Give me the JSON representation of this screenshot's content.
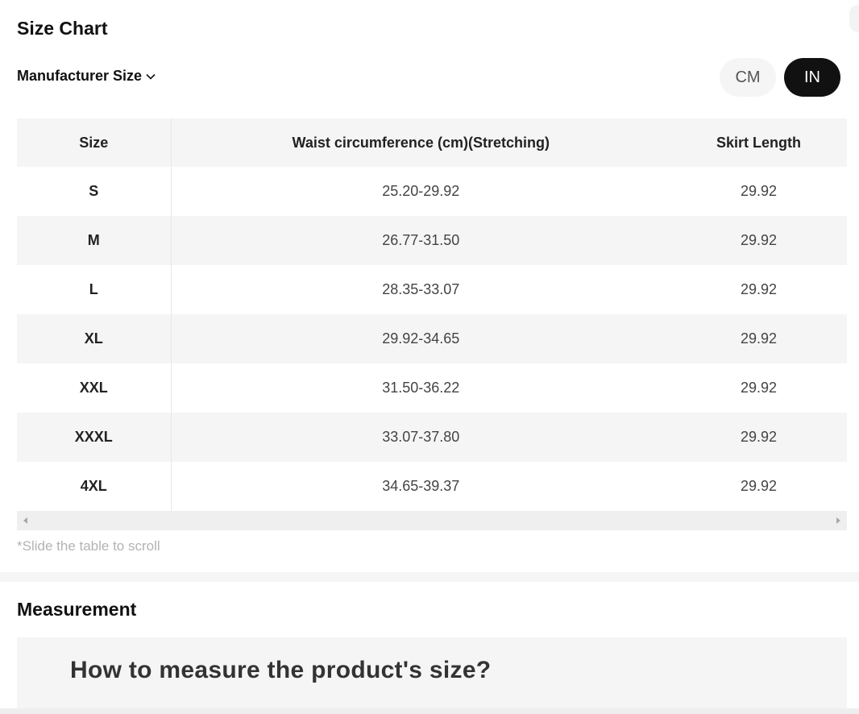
{
  "header": {
    "title": "Size Chart",
    "size_selector": {
      "label": "Manufacturer Size"
    },
    "units": [
      {
        "label": "CM",
        "active": false
      },
      {
        "label": "IN",
        "active": true
      }
    ]
  },
  "table": {
    "columns": [
      "Size",
      "Waist circumference (cm)(Stretching)",
      "Skirt Length"
    ],
    "rows": [
      {
        "size": "S",
        "waist": "25.20-29.92",
        "length": "29.92"
      },
      {
        "size": "M",
        "waist": "26.77-31.50",
        "length": "29.92"
      },
      {
        "size": "L",
        "waist": "28.35-33.07",
        "length": "29.92"
      },
      {
        "size": "XL",
        "waist": "29.92-34.65",
        "length": "29.92"
      },
      {
        "size": "XXL",
        "waist": "31.50-36.22",
        "length": "29.92"
      },
      {
        "size": "XXXL",
        "waist": "33.07-37.80",
        "length": "29.92"
      },
      {
        "size": "4XL",
        "waist": "34.65-39.37",
        "length": "29.92"
      }
    ],
    "scroll_hint": "*Slide the table to scroll"
  },
  "measurement": {
    "title": "Measurement",
    "question": "How to measure the product's size?"
  },
  "colors": {
    "active_unit_bg": "#111111",
    "row_shade": "#f5f5f5",
    "hint_text": "#b3b3b3"
  }
}
